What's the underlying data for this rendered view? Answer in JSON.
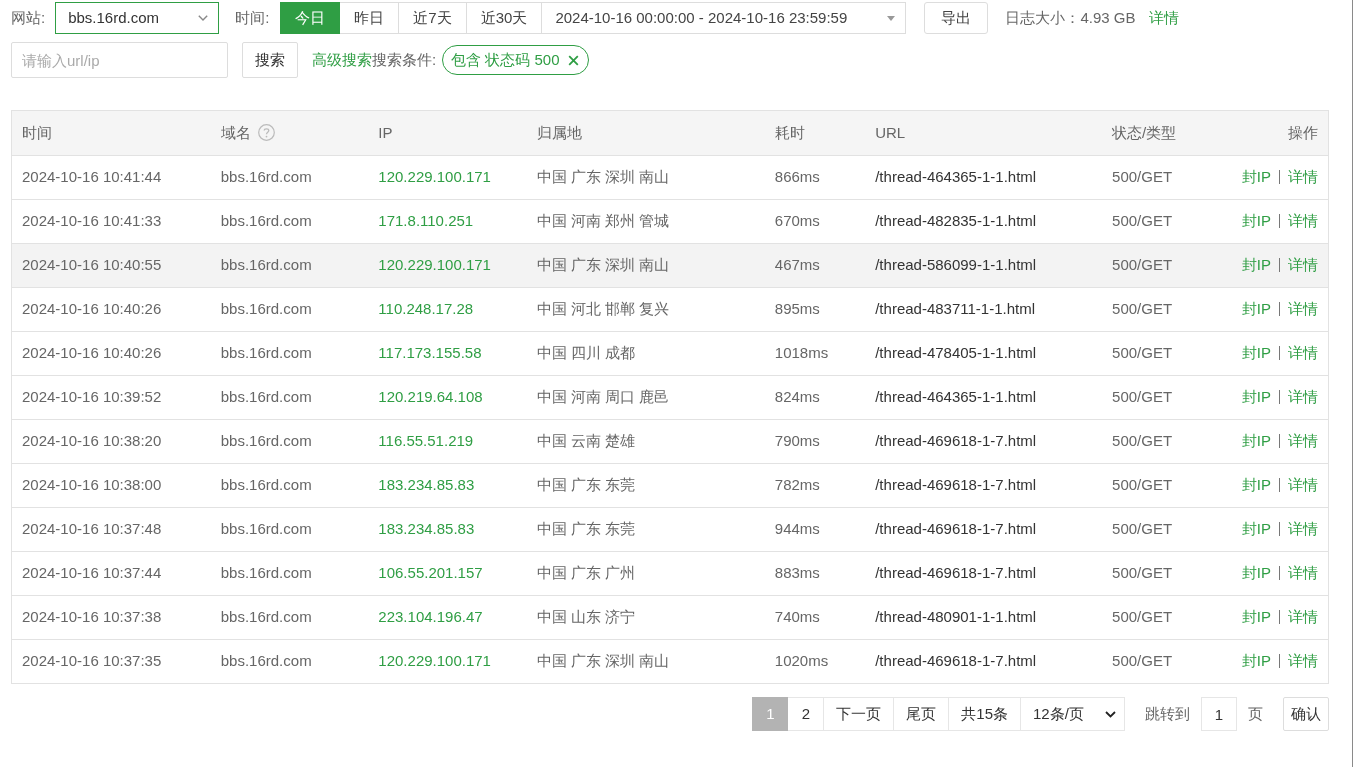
{
  "filter_bar": {
    "site_label": "网站:",
    "site_value": "bbs.16rd.com",
    "time_label": "时间:",
    "time_ranges": [
      {
        "label": "今日",
        "selected": true
      },
      {
        "label": "昨日",
        "selected": false
      },
      {
        "label": "近7天",
        "selected": false
      },
      {
        "label": "近30天",
        "selected": false
      }
    ],
    "date_range": "2024-10-16 00:00:00 - 2024-10-16 23:59:59",
    "export_button": "导出",
    "log_size": "日志大小：4.93 GB",
    "details_link": "详情"
  },
  "search": {
    "placeholder": "请输入url/ip",
    "button": "搜索",
    "advanced_link": "高级搜索",
    "conditions_label": "搜索条件:",
    "conditions": [
      {
        "label": "包含 状态码 500"
      }
    ]
  },
  "table": {
    "columns": [
      {
        "label": "时间",
        "help": false
      },
      {
        "label": "域名",
        "help": true
      },
      {
        "label": "IP",
        "help": false
      },
      {
        "label": "归属地",
        "help": false
      },
      {
        "label": "耗时",
        "help": false
      },
      {
        "label": "URL",
        "help": false
      },
      {
        "label": "状态/类型",
        "help": false
      },
      {
        "label": "操作",
        "help": false
      }
    ],
    "rows": [
      {
        "time": "2024-10-16 10:41:44",
        "domain": "bbs.16rd.com",
        "ip": "120.229.100.171",
        "location": "中国 广东 深圳 南山",
        "duration": "866ms",
        "url": "/thread-464365-1-1.html",
        "status": "500/GET",
        "actions": [
          "封IP",
          "详情"
        ],
        "highlighted": false
      },
      {
        "time": "2024-10-16 10:41:33",
        "domain": "bbs.16rd.com",
        "ip": "171.8.110.251",
        "location": "中国 河南 郑州 管城",
        "duration": "670ms",
        "url": "/thread-482835-1-1.html",
        "status": "500/GET",
        "actions": [
          "封IP",
          "详情"
        ],
        "highlighted": false
      },
      {
        "time": "2024-10-16 10:40:55",
        "domain": "bbs.16rd.com",
        "ip": "120.229.100.171",
        "location": "中国 广东 深圳 南山",
        "duration": "467ms",
        "url": "/thread-586099-1-1.html",
        "status": "500/GET",
        "actions": [
          "封IP",
          "详情"
        ],
        "highlighted": true
      },
      {
        "time": "2024-10-16 10:40:26",
        "domain": "bbs.16rd.com",
        "ip": "110.248.17.28",
        "location": "中国 河北 邯郸 复兴",
        "duration": "895ms",
        "url": "/thread-483711-1-1.html",
        "status": "500/GET",
        "actions": [
          "封IP",
          "详情"
        ],
        "highlighted": false
      },
      {
        "time": "2024-10-16 10:40:26",
        "domain": "bbs.16rd.com",
        "ip": "117.173.155.58",
        "location": "中国 四川 成都",
        "duration": "1018ms",
        "url": "/thread-478405-1-1.html",
        "status": "500/GET",
        "actions": [
          "封IP",
          "详情"
        ],
        "highlighted": false
      },
      {
        "time": "2024-10-16 10:39:52",
        "domain": "bbs.16rd.com",
        "ip": "120.219.64.108",
        "location": "中国 河南 周口 鹿邑",
        "duration": "824ms",
        "url": "/thread-464365-1-1.html",
        "status": "500/GET",
        "actions": [
          "封IP",
          "详情"
        ],
        "highlighted": false
      },
      {
        "time": "2024-10-16 10:38:20",
        "domain": "bbs.16rd.com",
        "ip": "116.55.51.219",
        "location": "中国 云南 楚雄",
        "duration": "790ms",
        "url": "/thread-469618-1-7.html",
        "status": "500/GET",
        "actions": [
          "封IP",
          "详情"
        ],
        "highlighted": false
      },
      {
        "time": "2024-10-16 10:38:00",
        "domain": "bbs.16rd.com",
        "ip": "183.234.85.83",
        "location": "中国 广东 东莞",
        "duration": "782ms",
        "url": "/thread-469618-1-7.html",
        "status": "500/GET",
        "actions": [
          "封IP",
          "详情"
        ],
        "highlighted": false
      },
      {
        "time": "2024-10-16 10:37:48",
        "domain": "bbs.16rd.com",
        "ip": "183.234.85.83",
        "location": "中国 广东 东莞",
        "duration": "944ms",
        "url": "/thread-469618-1-7.html",
        "status": "500/GET",
        "actions": [
          "封IP",
          "详情"
        ],
        "highlighted": false
      },
      {
        "time": "2024-10-16 10:37:44",
        "domain": "bbs.16rd.com",
        "ip": "106.55.201.157",
        "location": "中国 广东 广州",
        "duration": "883ms",
        "url": "/thread-469618-1-7.html",
        "status": "500/GET",
        "actions": [
          "封IP",
          "详情"
        ],
        "highlighted": false
      },
      {
        "time": "2024-10-16 10:37:38",
        "domain": "bbs.16rd.com",
        "ip": "223.104.196.47",
        "location": "中国 山东 济宁",
        "duration": "740ms",
        "url": "/thread-480901-1-1.html",
        "status": "500/GET",
        "actions": [
          "封IP",
          "详情"
        ],
        "highlighted": false
      },
      {
        "time": "2024-10-16 10:37:35",
        "domain": "bbs.16rd.com",
        "ip": "120.229.100.171",
        "location": "中国 广东 深圳 南山",
        "duration": "1020ms",
        "url": "/thread-469618-1-7.html",
        "status": "500/GET",
        "actions": [
          "封IP",
          "详情"
        ],
        "highlighted": false
      }
    ]
  },
  "pagination": {
    "pages": [
      {
        "label": "1",
        "selected": true
      },
      {
        "label": "2",
        "selected": false
      }
    ],
    "next": "下一页",
    "last": "尾页",
    "total": "共15条",
    "page_size": "12条/页",
    "jump_label": "跳转到",
    "jump_value": "1",
    "page_unit": "页",
    "confirm": "确认"
  }
}
